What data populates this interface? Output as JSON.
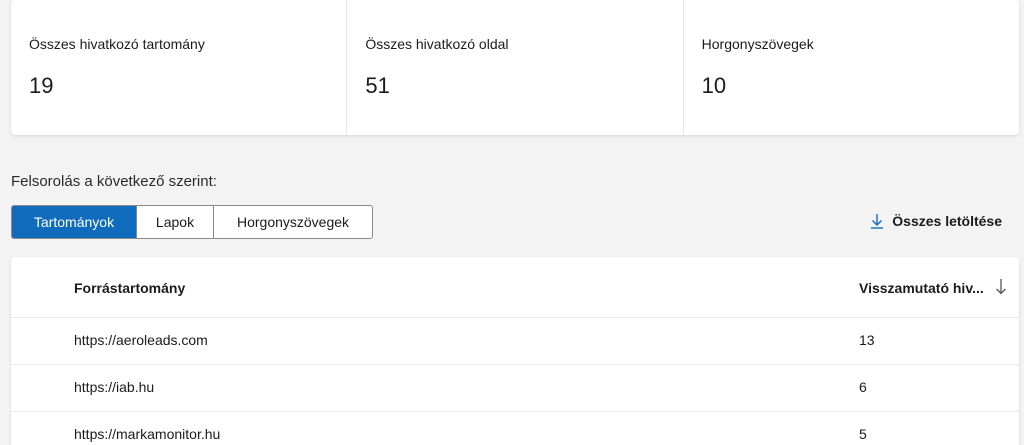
{
  "summary": {
    "cards": [
      {
        "label": "Összes hivatkozó tartomány",
        "value": "19"
      },
      {
        "label": "Összes hivatkozó oldal",
        "value": "51"
      },
      {
        "label": "Horgonyszövegek",
        "value": "10"
      }
    ]
  },
  "list_by": {
    "label": "Felsorolás a következő szerint:",
    "tabs": [
      "Tartományok",
      "Lapok",
      "Horgonyszövegek"
    ],
    "selected": "Tartományok"
  },
  "download": {
    "label": "Összes letöltése",
    "icon": "download-arrow-icon"
  },
  "table": {
    "columns": [
      "Forrástartomány",
      "Visszamutató hiv..."
    ],
    "sort_icon": "arrow-down-icon",
    "rows": [
      {
        "domain": "https://aeroleads.com",
        "count": "13"
      },
      {
        "domain": "https://iab.hu",
        "count": "6"
      },
      {
        "domain": "https://markamonitor.hu",
        "count": "5"
      }
    ]
  },
  "colors": {
    "accent": "#0f6cbd",
    "background": "#f3f3f3",
    "card": "#ffffff"
  }
}
